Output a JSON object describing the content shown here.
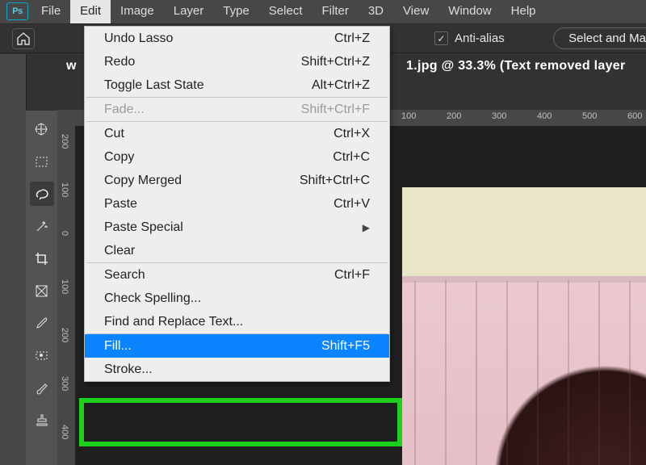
{
  "menubar": {
    "badge": "Ps",
    "items": [
      "File",
      "Edit",
      "Image",
      "Layer",
      "Type",
      "Select",
      "Filter",
      "3D",
      "View",
      "Window",
      "Help"
    ],
    "active_index": 1
  },
  "options_bar": {
    "anti_alias_label": "Anti-alias",
    "anti_alias_checked": true,
    "select_btn": "Select and Ma"
  },
  "breadcrumb": {
    "left_letter": "w",
    "active_doc": "1.jpg @ 33.3% (Text removed layer"
  },
  "ruler_h": [
    "100",
    "200",
    "300",
    "400",
    "500",
    "600"
  ],
  "ruler_v": [
    "200",
    "100",
    "0",
    "100",
    "200",
    "300",
    "400"
  ],
  "tools": [
    "move",
    "marquee",
    "lasso",
    "wand",
    "crop",
    "frame",
    "eyedropper",
    "brush-dots",
    "brush",
    "stamp"
  ],
  "active_tool_index": 2,
  "edit_menu": [
    {
      "label": "Undo Lasso",
      "short": "Ctrl+Z",
      "enabled": true
    },
    {
      "label": "Redo",
      "short": "Shift+Ctrl+Z",
      "enabled": true
    },
    {
      "label": "Toggle Last State",
      "short": "Alt+Ctrl+Z",
      "enabled": true
    },
    {
      "sep": true
    },
    {
      "label": "Fade...",
      "short": "Shift+Ctrl+F",
      "enabled": false
    },
    {
      "sep": true
    },
    {
      "label": "Cut",
      "short": "Ctrl+X",
      "enabled": true
    },
    {
      "label": "Copy",
      "short": "Ctrl+C",
      "enabled": true
    },
    {
      "label": "Copy Merged",
      "short": "Shift+Ctrl+C",
      "enabled": true
    },
    {
      "label": "Paste",
      "short": "Ctrl+V",
      "enabled": true
    },
    {
      "label": "Paste Special",
      "sub": true,
      "enabled": true
    },
    {
      "label": "Clear",
      "enabled": true
    },
    {
      "sep": true
    },
    {
      "label": "Search",
      "short": "Ctrl+F",
      "enabled": true
    },
    {
      "label": "Check Spelling...",
      "enabled": true
    },
    {
      "label": "Find and Replace Text...",
      "enabled": true
    },
    {
      "sep": true
    },
    {
      "label": "Fill...",
      "short": "Shift+F5",
      "enabled": true,
      "highlight": true
    },
    {
      "label": "Stroke...",
      "enabled": true
    }
  ]
}
